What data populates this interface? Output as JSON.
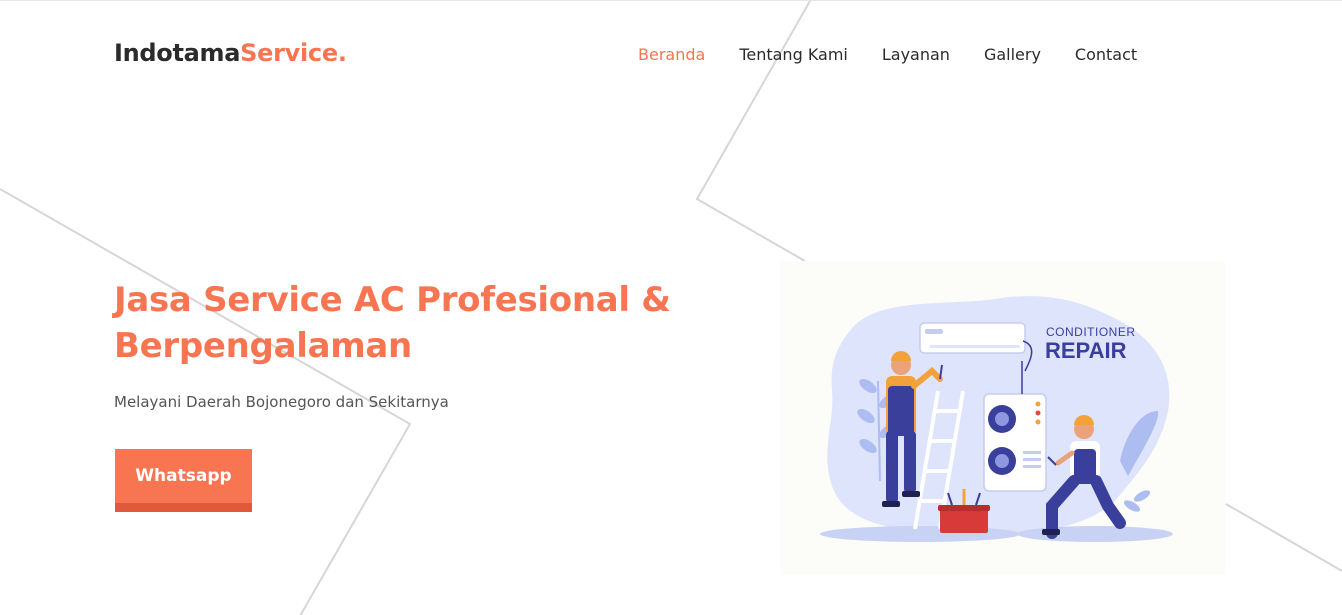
{
  "header": {
    "logo_dark": "Indotama",
    "logo_accent": "Service."
  },
  "nav": {
    "items": [
      {
        "label": "Beranda",
        "active": true
      },
      {
        "label": "Tentang Kami",
        "active": false
      },
      {
        "label": "Layanan",
        "active": false
      },
      {
        "label": "Gallery",
        "active": false
      },
      {
        "label": "Contact",
        "active": false
      }
    ]
  },
  "hero": {
    "title_line1": "Jasa Service AC Profesional &",
    "title_line2": "Berpengalaman",
    "subtitle": "Melayani Daerah Bojonegoro dan Sekitarnya",
    "button_label": "Whatsapp"
  },
  "illustration": {
    "caption_line1": "CONDITIONER",
    "caption_line2": "REPAIR"
  },
  "colors": {
    "accent": "#f77551",
    "accent_dark": "#e0593a",
    "text_dark": "#2b2b2b",
    "illus_blue": "#dde4fb",
    "illus_navy": "#3b3f9c"
  }
}
